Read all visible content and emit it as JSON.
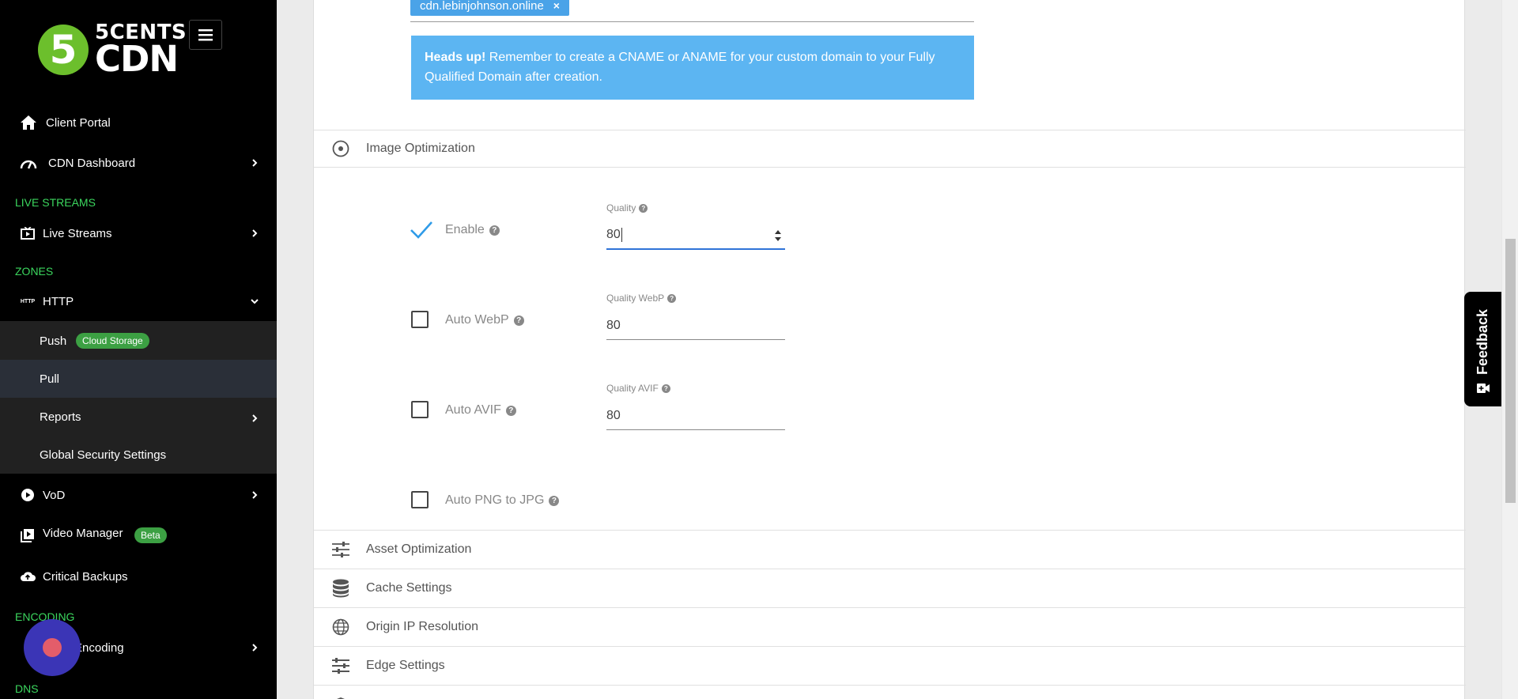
{
  "brand": {
    "logo_numeral": "5",
    "logo_line1": "5CENTS",
    "logo_line2": "CDN"
  },
  "sidebar": {
    "client_portal": "Client Portal",
    "cdn_dashboard": "CDN Dashboard",
    "section_live_streams": "LIVE STREAMS",
    "live_streams": "Live Streams",
    "section_zones": "ZONES",
    "http": "HTTP",
    "http_icon_text": "HTTP",
    "push": "Push",
    "push_badge": "Cloud Storage",
    "pull": "Pull",
    "reports": "Reports",
    "global_security": "Global Security Settings",
    "vod": "VoD",
    "video_manager": "Video Manager",
    "video_manager_badge": "Beta",
    "critical_backups": "Critical Backups",
    "section_encoding": "ENCODING",
    "encoding": "Encoding",
    "section_dns": "DNS"
  },
  "domain_field": {
    "chip": "cdn.lebinjohnson.online",
    "chip_remove": "×"
  },
  "alert": {
    "strong": "Heads up!",
    "text": " Remember to create a CNAME or ANAME for your custom domain to your Fully Qualified Domain after creation."
  },
  "sections": {
    "image_optimization": "Image Optimization",
    "asset_optimization": "Asset Optimization",
    "cache_settings": "Cache Settings",
    "origin_ip_resolution": "Origin IP Resolution",
    "edge_settings": "Edge Settings"
  },
  "image_opt": {
    "enable_label": "Enable",
    "enable_checked": true,
    "quality_label": "Quality",
    "quality_value": "80",
    "auto_webp_label": "Auto WebP",
    "quality_webp_label": "Quality WebP",
    "quality_webp_value": "80",
    "auto_avif_label": "Auto AVIF",
    "quality_avif_label": "Quality AVIF",
    "quality_avif_value": "80",
    "auto_png_label": "Auto PNG to JPG",
    "help_glyph": "?"
  },
  "feedback": {
    "label": "Feedback"
  },
  "colors": {
    "sidebar_bg": "#000000",
    "section_green": "#3bd65e",
    "badge_green": "#3ca043",
    "alert_blue": "#5cb5f2",
    "chip_blue": "#4aa3e8",
    "focus_blue": "#2f73d8"
  }
}
